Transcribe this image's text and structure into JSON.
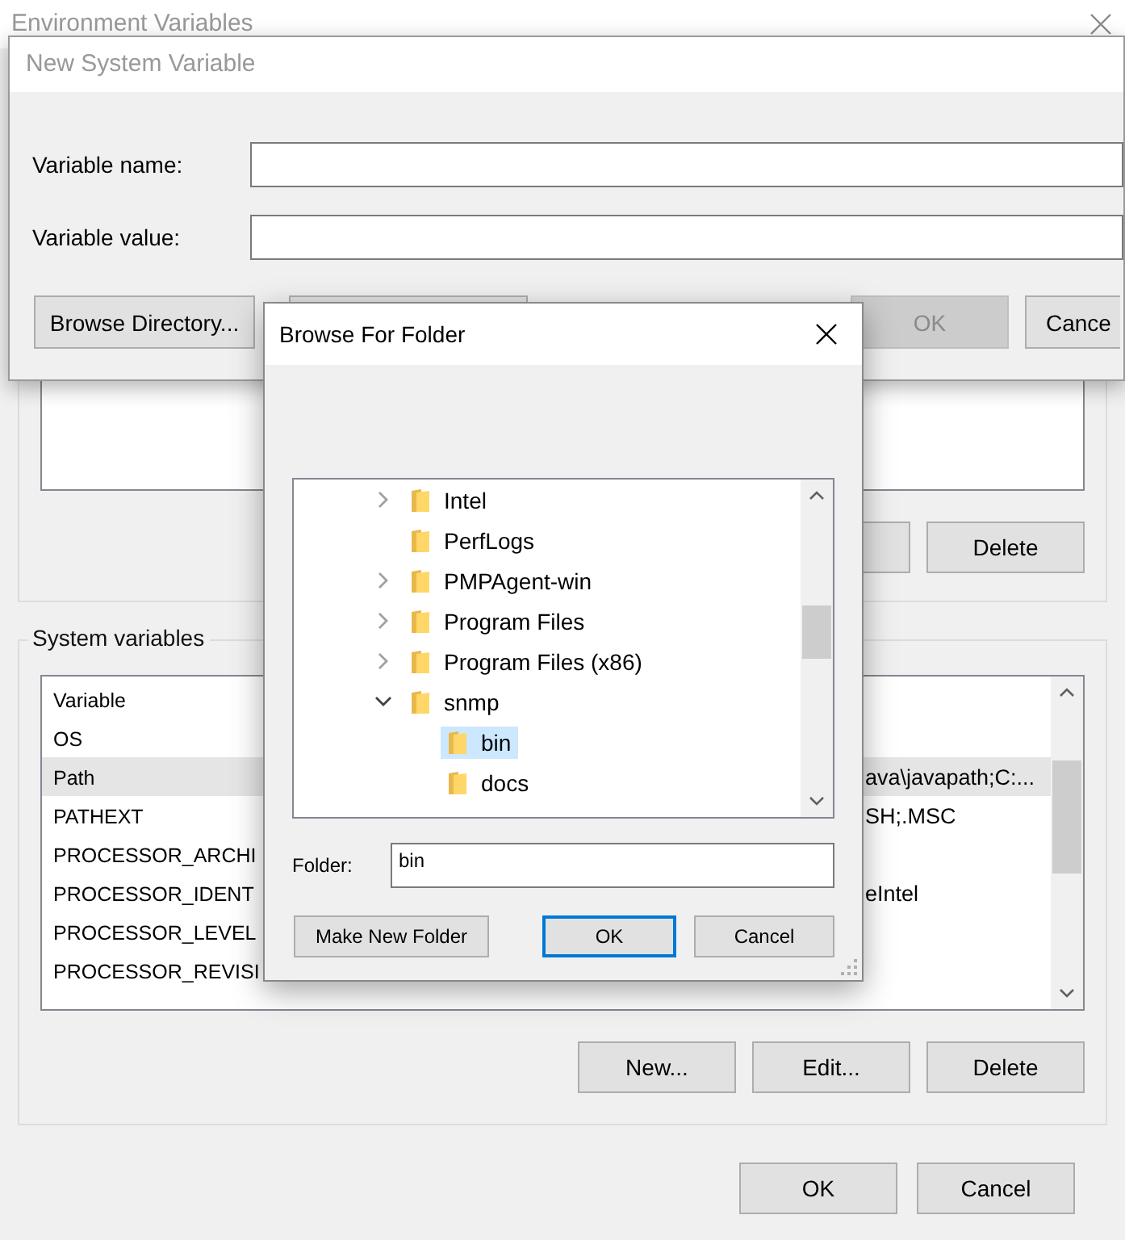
{
  "environment_variables": {
    "title": "Environment Variables",
    "user_variables": {
      "buttons": [
        {
          "kind": "covered"
        },
        {
          "kind": "button",
          "label": "Delete"
        }
      ]
    },
    "system_variables": {
      "title": "System variables",
      "columns": [
        "Variable"
      ],
      "rows": [
        {
          "name": "OS",
          "selected": false
        },
        {
          "name": "Path",
          "value": "ava\\javapath;C:...",
          "selected": true
        },
        {
          "name": "PATHEXT",
          "value": "SH;.MSC",
          "selected": false
        },
        {
          "name": "PROCESSOR_ARCHI",
          "selected": false
        },
        {
          "name": "PROCESSOR_IDENT",
          "value": "eIntel",
          "selected": false
        },
        {
          "name": "PROCESSOR_LEVEL",
          "selected": false
        },
        {
          "name": "PROCESSOR_REVISI",
          "selected": false
        }
      ],
      "buttons": [
        "New...",
        "Edit...",
        "Delete"
      ]
    },
    "buttons": [
      "OK",
      "Cancel"
    ]
  },
  "new_system_variable": {
    "title": "New System Variable",
    "fields": [
      {
        "label": "Variable name:"
      },
      {
        "label": "Variable value:"
      }
    ],
    "buttons": [
      {
        "kind": "button",
        "label": "Browse Directory...",
        "disabled": false
      },
      {
        "kind": "covered"
      },
      {
        "kind": "button",
        "label": "OK",
        "disabled": true
      },
      {
        "kind": "button",
        "label": "Cance",
        "disabled": false
      }
    ]
  },
  "browse_for_folder": {
    "title": "Browse For Folder",
    "tree": [
      {
        "label": "Intel",
        "expanded": false,
        "selected": false
      },
      {
        "label": "PerfLogs",
        "selected": false
      },
      {
        "label": "PMPAgent-win",
        "expanded": false,
        "selected": false
      },
      {
        "label": "Program Files",
        "expanded": false,
        "selected": false
      },
      {
        "label": "Program Files (x86)",
        "expanded": false,
        "selected": false
      },
      {
        "label": "snmp",
        "expanded": true,
        "selected": false,
        "children": [
          {
            "label": "bin",
            "selected": true
          },
          {
            "label": "docs",
            "selected": false
          }
        ]
      }
    ],
    "folder": {
      "label": "Folder:",
      "value": "bin"
    },
    "buttons": [
      {
        "label": "Make New Folder",
        "default": false
      },
      {
        "label": "OK",
        "default": true
      },
      {
        "label": "Cancel",
        "default": false
      }
    ]
  }
}
